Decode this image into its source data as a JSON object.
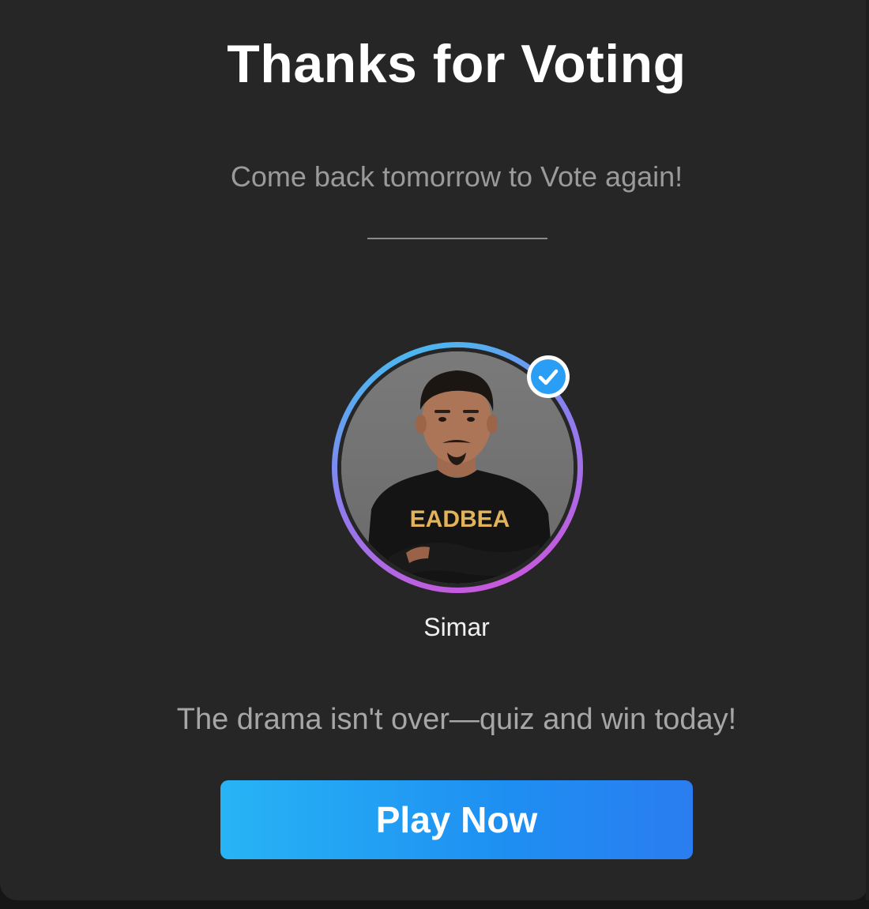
{
  "dialog": {
    "title": "Thanks for Voting",
    "subtitle": "Come back tomorrow to Vote again!",
    "voted_for": {
      "name": "Simar",
      "verified": true,
      "shirt_text": "EADBEA",
      "ring_colors": [
        "#38c8f0",
        "#8a7ff0",
        "#d74fd8"
      ]
    },
    "promo_text": "The drama isn't over—quiz and win today!",
    "cta_label": "Play Now"
  },
  "colors": {
    "background": "#262626",
    "title": "#ffffff",
    "muted_text": "#9a9a9a",
    "accent": "#1e8ff2",
    "verified": "#2a9df4"
  },
  "icons": {
    "verified": "check-badge-icon",
    "avatar": "user-photo"
  }
}
